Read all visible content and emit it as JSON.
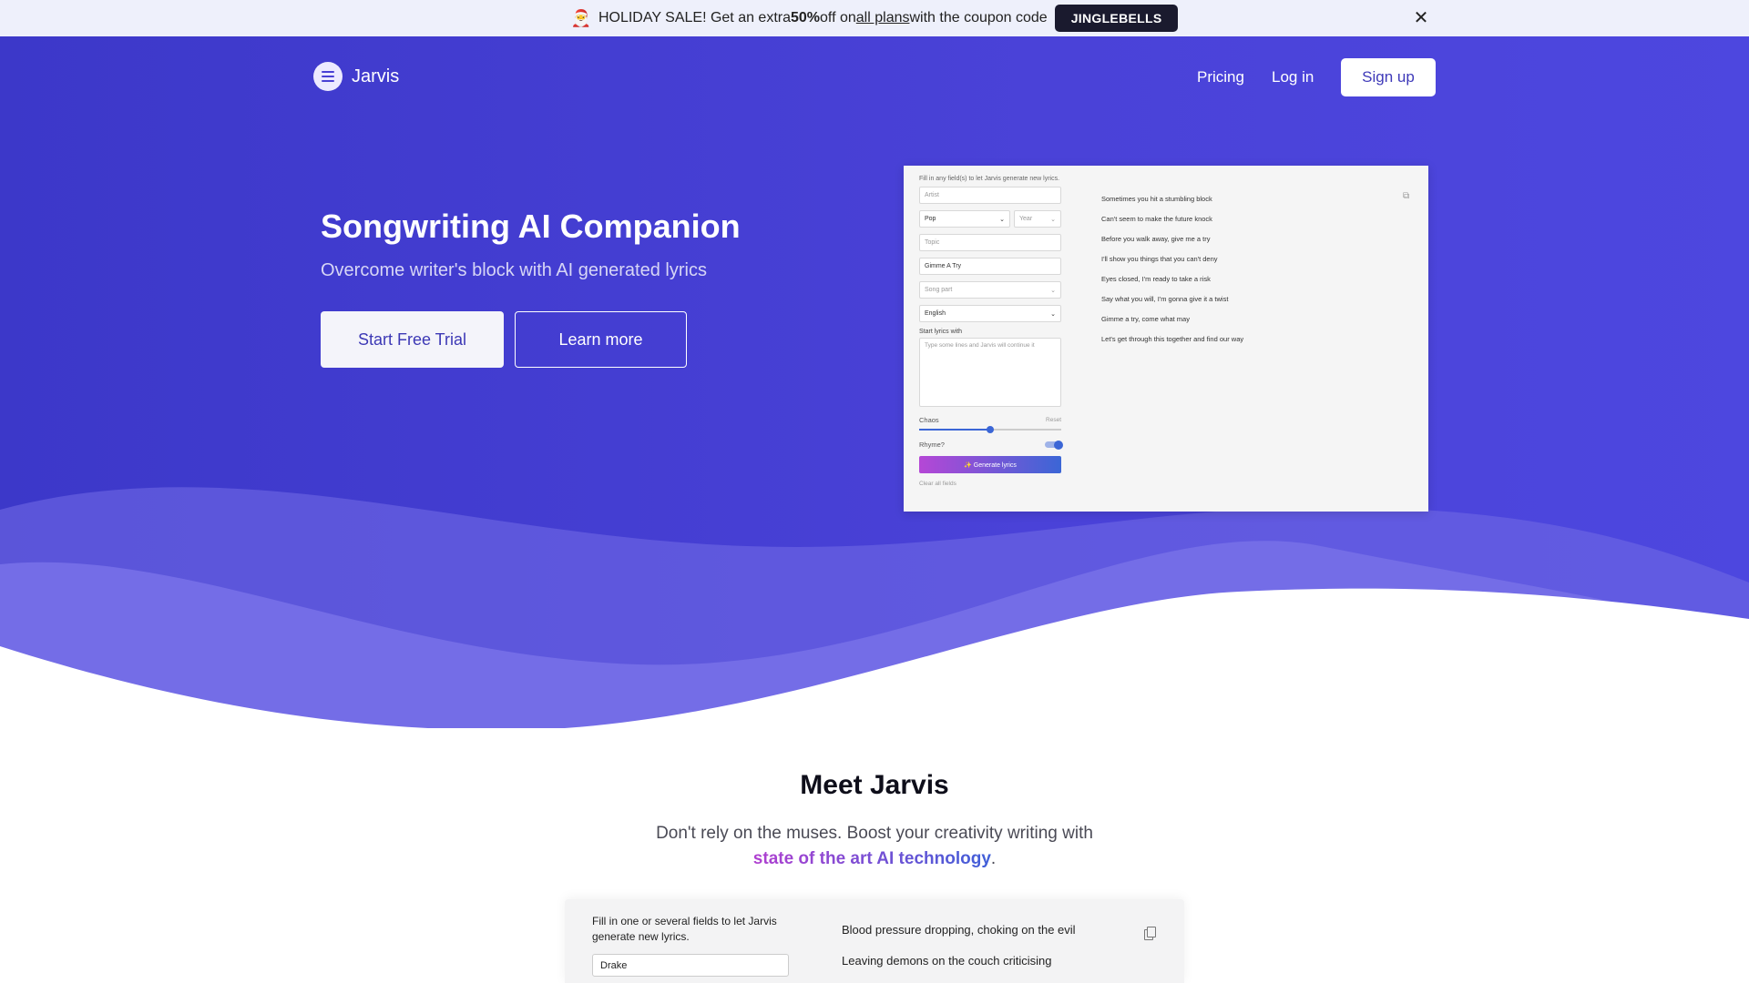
{
  "banner": {
    "emoji": "🎅",
    "text_before": "HOLIDAY SALE! Get an extra ",
    "discount": "50%",
    "text_mid": " off on ",
    "plans_link": "all plans",
    "text_after": " with the coupon code",
    "coupon": "JINGLEBELLS",
    "close": "✕"
  },
  "nav": {
    "brand": "Jarvis",
    "pricing": "Pricing",
    "login": "Log in",
    "signup": "Sign up"
  },
  "hero": {
    "title": "Songwriting AI Companion",
    "subtitle": "Overcome writer's block with AI generated lyrics",
    "trial_button": "Start Free Trial",
    "learn_button": "Learn more"
  },
  "preview": {
    "intro": "Fill in any field(s) to let Jarvis generate new lyrics.",
    "artist_placeholder": "Artist",
    "genre": "Pop",
    "year_placeholder": "Year",
    "topic_placeholder": "Topic",
    "title_value": "Gimme A Try",
    "song_part_placeholder": "Song part",
    "language": "English",
    "start_lyrics_label": "Start lyrics with",
    "start_lyrics_placeholder": "Type some lines and Jarvis will continue it",
    "chaos_label": "Chaos",
    "chaos_level": 0.5,
    "reset": "Reset",
    "rhyme_label": "Rhyme?",
    "rhyme_on": true,
    "generate_button": "✨ Generate lyrics",
    "clear_fields": "Clear all fields",
    "lyrics": [
      "Sometimes you hit a stumbling block",
      "Can't seem to make the future knock",
      "Before you walk away, give me a try",
      "I'll show you things that you can't deny",
      "Eyes closed, I'm ready to take a risk",
      "Say what you will, I'm gonna give it a twist",
      "Gimme a try, come what may",
      "Let's get through this together and find our way"
    ]
  },
  "meet": {
    "title": "Meet Jarvis",
    "subtitle": "Don't rely on the muses. Boost your creativity writing with",
    "highlight": "state of the art AI technology",
    "period": "."
  },
  "demo": {
    "intro": "Fill in one or several fields to let Jarvis generate new lyrics.",
    "artist_value": "Drake",
    "lyrics": [
      "Blood pressure dropping, choking on the evil",
      "Leaving demons on the couch criticising"
    ]
  },
  "colors": {
    "hero_bg": "#4840d4",
    "accent_purple": "#b03fd0",
    "accent_blue": "#3f5fd8"
  }
}
